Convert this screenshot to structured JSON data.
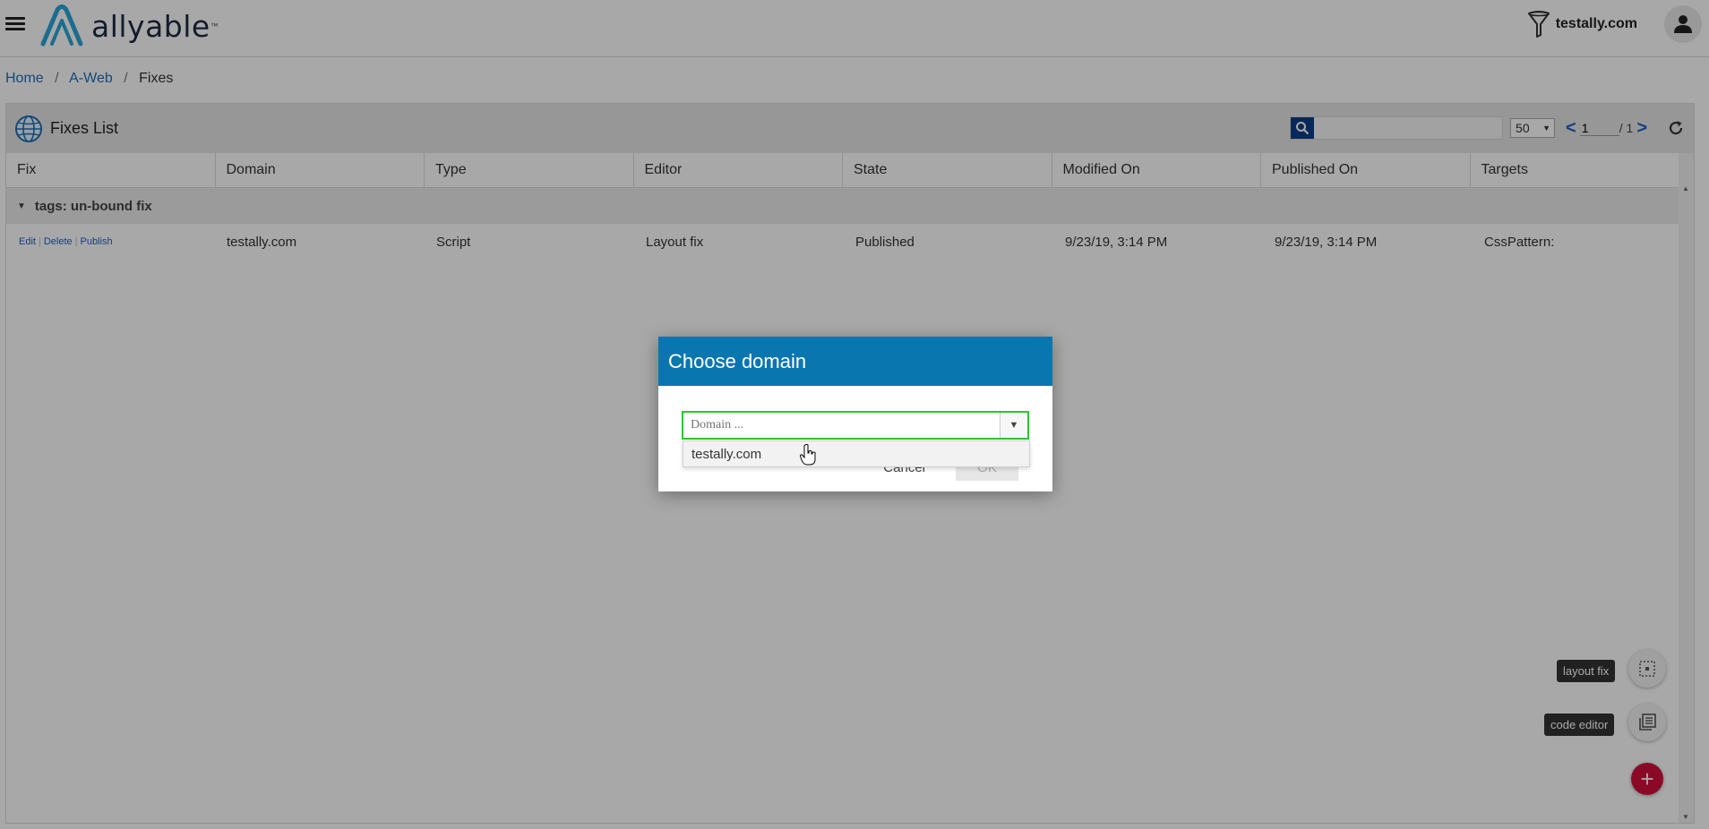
{
  "header": {
    "logo_text": "allyable",
    "logo_tm": "™",
    "domain_filter": "testally.com"
  },
  "breadcrumb": {
    "items": [
      "Home",
      "A-Web"
    ],
    "current": "Fixes",
    "separator": "/"
  },
  "panel": {
    "title": "Fixes List",
    "page_size": "50",
    "current_page": "1",
    "total_pages": "/ 1",
    "prev": "<",
    "next": ">"
  },
  "table": {
    "columns": [
      "Fix",
      "Domain",
      "Type",
      "Editor",
      "State",
      "Modified On",
      "Published On",
      "Targets"
    ],
    "group_label": "tags: un-bound fix",
    "rows": [
      {
        "actions": [
          "Edit",
          "Delete",
          "Publish"
        ],
        "domain": "testally.com",
        "type": "Script",
        "editor": "Layout fix",
        "state": "Published",
        "modified_on": "9/23/19, 3:14 PM",
        "published_on": "9/23/19, 3:14 PM",
        "targets": "CssPattern:"
      }
    ]
  },
  "fabs": {
    "layout_fix_label": "layout fix",
    "code_editor_label": "code editor",
    "add_symbol": "+"
  },
  "modal": {
    "title": "Choose domain",
    "domain_placeholder": "Domain ...",
    "dropdown_options": [
      "testally.com"
    ],
    "cancel_label": "Cancel",
    "ok_label": "OK"
  },
  "colors": {
    "modal_header": "#0a76b0",
    "focus_border": "#30c330",
    "add_button": "#d20f3a",
    "link": "#1f6fb5",
    "search_button": "#0c3d86"
  }
}
